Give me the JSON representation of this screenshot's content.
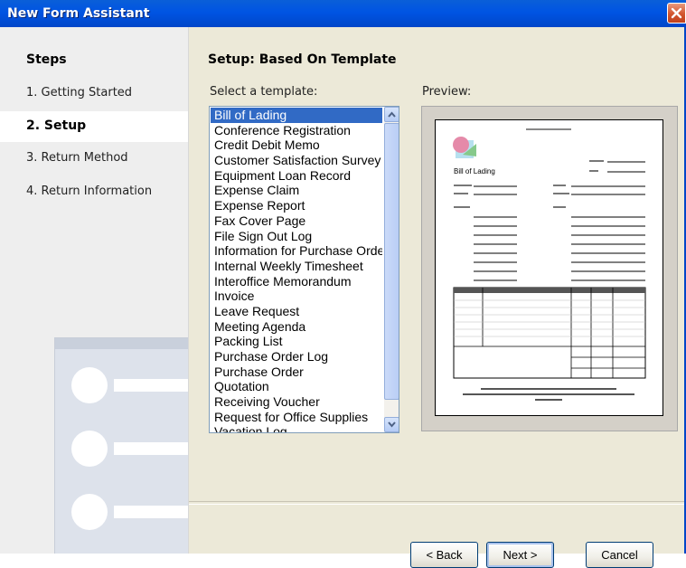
{
  "window": {
    "title": "New Form Assistant"
  },
  "sidebar": {
    "heading": "Steps",
    "steps": [
      {
        "label": "1. Getting Started"
      },
      {
        "label": "2. Setup",
        "active": true
      },
      {
        "label": "3. Return Method"
      },
      {
        "label": "4. Return Information"
      }
    ]
  },
  "main": {
    "title": "Setup: Based On Template",
    "select_label": "Select a template:",
    "preview_label": "Preview:",
    "templates": [
      "Bill of Lading",
      "Conference Registration",
      "Credit Debit Memo",
      "Customer Satisfaction Survey",
      "Equipment Loan Record",
      "Expense Claim",
      "Expense Report",
      "Fax Cover Page",
      "File Sign Out Log",
      "Information for Purchase Order",
      "Internal Weekly Timesheet",
      "Interoffice Memorandum",
      "Invoice",
      "Leave Request",
      "Meeting Agenda",
      "Packing List",
      "Purchase Order Log",
      "Purchase Order",
      "Quotation",
      "Receiving Voucher",
      "Request for Office Supplies",
      "Vacation Log"
    ],
    "selected_template": "Bill of Lading"
  },
  "preview": {
    "doc_title": "Bill of Lading"
  },
  "buttons": {
    "back": "< Back",
    "next": "Next >",
    "cancel": "Cancel"
  },
  "colors": {
    "titlebar": "#0054e3",
    "selection": "#316ac5",
    "close": "#d2552e"
  }
}
